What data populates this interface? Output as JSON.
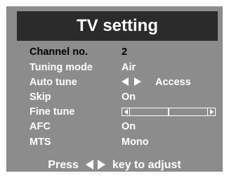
{
  "title": "TV setting",
  "menu": {
    "channel": {
      "label": "Channel no.",
      "value": "2"
    },
    "tuning_mode": {
      "label": "Tuning mode",
      "value": "Air"
    },
    "auto_tune": {
      "label": "Auto tune",
      "value": "Access"
    },
    "skip": {
      "label": "Skip",
      "value": "On"
    },
    "fine_tune": {
      "label": "Fine tune",
      "level": 0.5
    },
    "afc": {
      "label": "AFC",
      "value": "On"
    },
    "mts": {
      "label": "MTS",
      "value": "Mono"
    }
  },
  "footer": {
    "press": "Press",
    "hint": "key to adjust"
  },
  "colors": {
    "panel": "#8c8c8c",
    "title_bar": "#2b2b2b",
    "text": "#ffffff",
    "selected_text": "#000000"
  }
}
